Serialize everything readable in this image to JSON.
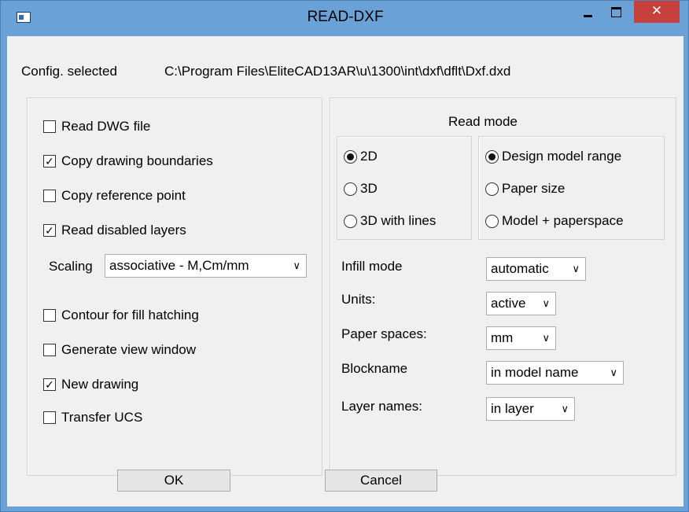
{
  "window": {
    "title": "READ-DXF",
    "close_symbol": "✕"
  },
  "config": {
    "label": "Config. selected",
    "path": "C:\\Program Files\\EliteCAD13AR\\u\\1300\\int\\dxf\\dflt\\Dxf.dxd"
  },
  "left": {
    "checkboxes": [
      {
        "label": "Read DWG file",
        "checked": false
      },
      {
        "label": "Copy drawing boundaries",
        "checked": true
      },
      {
        "label": "Copy reference point",
        "checked": false
      },
      {
        "label": "Read disabled layers",
        "checked": true
      }
    ],
    "scaling": {
      "label": "Scaling",
      "value": "associative - M,Cm/mm"
    },
    "checkboxes2": [
      {
        "label": "Contour for fill hatching",
        "checked": false
      },
      {
        "label": "Generate view window",
        "checked": false
      },
      {
        "label": "New drawing",
        "checked": true
      },
      {
        "label": "Transfer UCS",
        "checked": false
      }
    ]
  },
  "right": {
    "read_mode_title": "Read mode",
    "dimension": [
      {
        "label": "2D",
        "selected": true
      },
      {
        "label": "3D",
        "selected": false
      },
      {
        "label": "3D with lines",
        "selected": false
      }
    ],
    "range": [
      {
        "label": "Design model range",
        "selected": true
      },
      {
        "label": "Paper size",
        "selected": false
      },
      {
        "label": "Model + paperspace",
        "selected": false
      }
    ],
    "fields": [
      {
        "label": "Infill mode",
        "value": "automatic"
      },
      {
        "label": "Units:",
        "value": "active"
      },
      {
        "label": "Paper spaces:",
        "value": "mm"
      },
      {
        "label": "Blockname",
        "value": "in model name"
      },
      {
        "label": "Layer names:",
        "value": "in layer"
      }
    ]
  },
  "buttons": {
    "ok": "OK",
    "cancel": "Cancel"
  },
  "glyphs": {
    "check": "✓",
    "chevron": "∨"
  }
}
